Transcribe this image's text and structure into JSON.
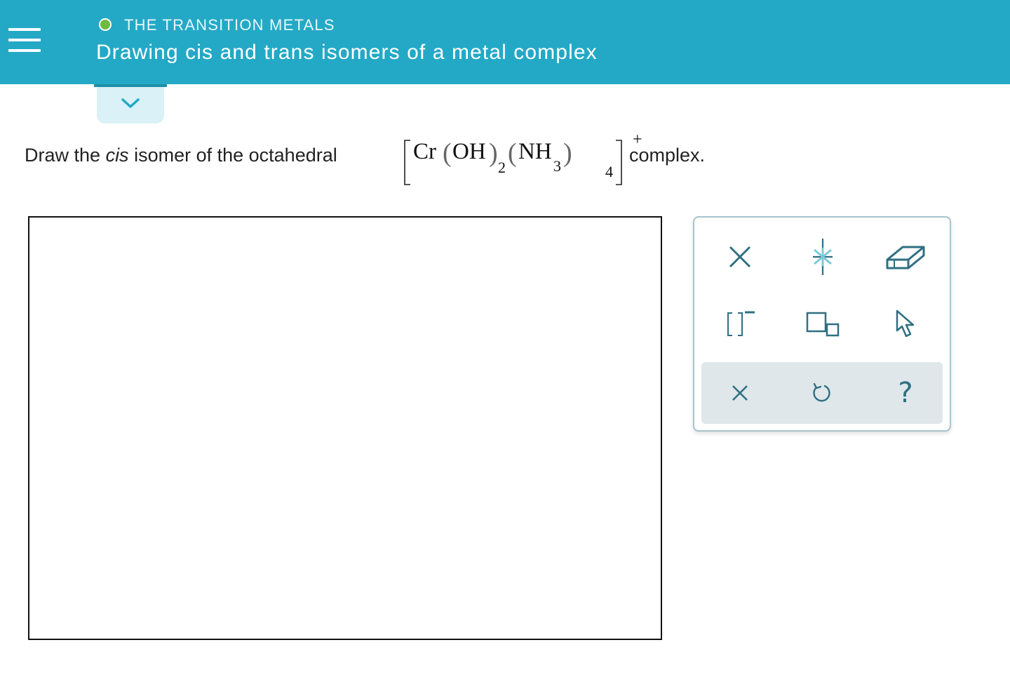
{
  "header": {
    "topic": "THE TRANSITION METALS",
    "title": "Drawing cis and trans isomers of a metal complex",
    "menu_icon": "hamburger-menu-icon",
    "status_icon": "green-circle-icon"
  },
  "expand": {
    "icon": "chevron-down-icon"
  },
  "question": {
    "lead": "Draw the",
    "emphasis": "cis",
    "middle": "isomer of the octahedral",
    "formula": {
      "metal": "Cr",
      "ligand1": "OH",
      "ligand1_count": "2",
      "ligand2": "NH",
      "ligand2_sub": "3",
      "ligand2_count": "4",
      "charge": "+"
    },
    "tail": "complex."
  },
  "toolbox": {
    "row1": [
      "single-bond-x-icon",
      "lone-pair-star-icon",
      "eraser-icon"
    ],
    "row2": [
      "brackets-charge-icon",
      "resize-boxes-icon",
      "pointer-cursor-icon"
    ],
    "actions": {
      "clear": "close-x-icon",
      "undo": "undo-icon",
      "help": "?"
    }
  },
  "colors": {
    "header_bg": "#23a9c6",
    "accent_dark": "#1f8fa8",
    "tab_bg": "#d9f1f7",
    "status_green": "#6dbb3f",
    "icon": "#2f6f82",
    "action_bar_bg": "#dfe7ea"
  }
}
